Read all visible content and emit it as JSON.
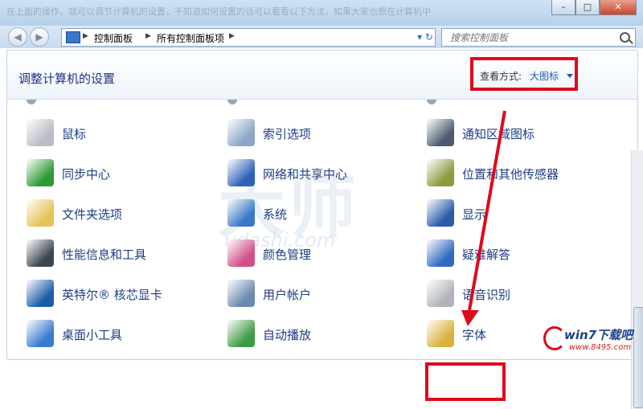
{
  "window": {
    "blurred_text": "在上面的操作，就可以调节计算机的设置，不知道如何设置的话可以看看以下方法，如果大家也想在计算机中",
    "controls": {
      "minimize": "–",
      "maximize": "□",
      "close": "✕"
    }
  },
  "address": {
    "crumbs": [
      "控制面板",
      "所有控制面板项"
    ],
    "search_placeholder": "搜索控制面板"
  },
  "header": {
    "title": "调整计算机的设置",
    "view_by_label": "查看方式:",
    "view_by_value": "大图标"
  },
  "items": [
    {
      "label": "鼠标",
      "color": "#b8bcc4"
    },
    {
      "label": "索引选项",
      "color": "#8ca6c6"
    },
    {
      "label": "通知区域图标",
      "color": "#4b5a6e"
    },
    {
      "label": "同步中心",
      "color": "#2e9a36"
    },
    {
      "label": "网络和共享中心",
      "color": "#2e62b8"
    },
    {
      "label": "位置和其他传感器",
      "color": "#8c9a3c"
    },
    {
      "label": "文件夹选项",
      "color": "#e6c25a"
    },
    {
      "label": "系统",
      "color": "#3a78c8"
    },
    {
      "label": "显示",
      "color": "#2a5aa8"
    },
    {
      "label": "性能信息和工具",
      "color": "#3c4650"
    },
    {
      "label": "颜色管理",
      "color": "#d24e8a"
    },
    {
      "label": "疑难解答",
      "color": "#2f6ac0"
    },
    {
      "label": "英特尔® 核芯显卡",
      "color": "#1a5ca8"
    },
    {
      "label": "用户帐户",
      "color": "#6a8ab0"
    },
    {
      "label": "语音识别",
      "color": "#b0b4ba"
    },
    {
      "label": "桌面小工具",
      "color": "#3b7ad0"
    },
    {
      "label": "自动播放",
      "color": "#3e9a46"
    },
    {
      "label": "字体",
      "color": "#d8b23c"
    }
  ],
  "watermark": {
    "text": "大师",
    "url": "udashi.com"
  },
  "logo": {
    "text": "win7下载吧",
    "url": "www.8495.com"
  },
  "colors": {
    "accent": "#e0081c",
    "link": "#1d3c84"
  }
}
